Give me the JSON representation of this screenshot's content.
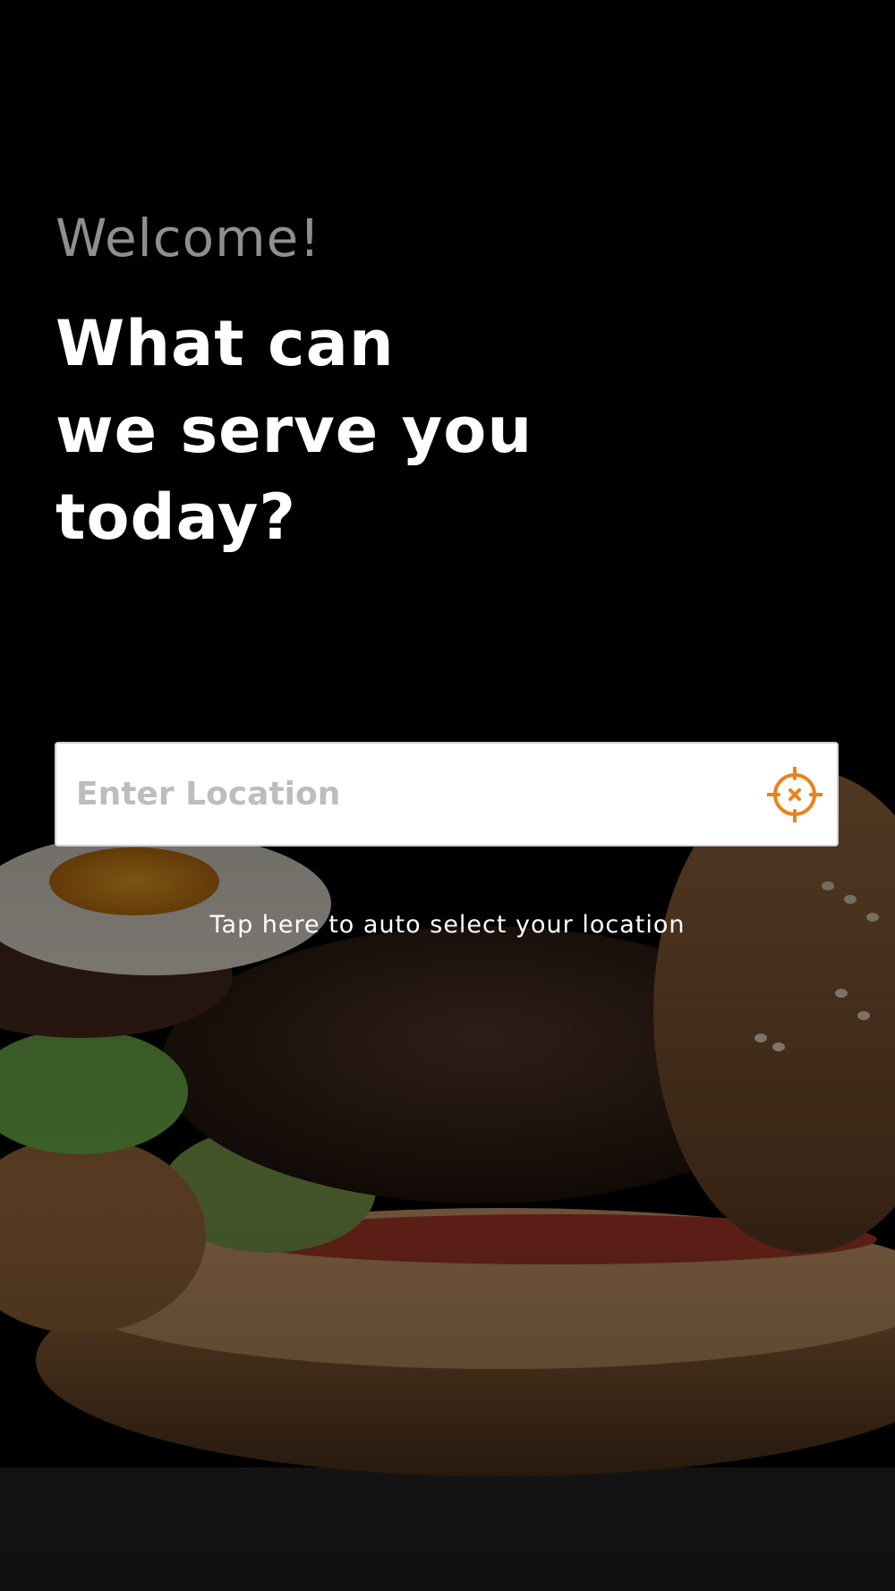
{
  "welcome": "Welcome!",
  "headline": {
    "line1": "What can",
    "line2": "we serve you",
    "line3": "today?"
  },
  "location": {
    "placeholder": "Enter Location",
    "value": "",
    "icon": "crosshair-locate-icon",
    "accent_color": "#E8831E"
  },
  "auto_select_text": "Tap here to auto select your location"
}
